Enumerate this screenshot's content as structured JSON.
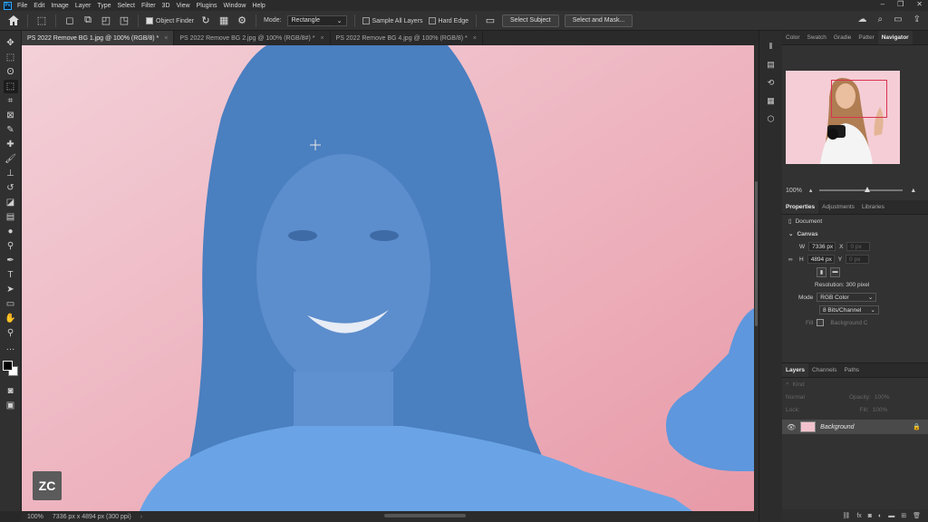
{
  "app": {
    "logo": "Ps"
  },
  "menu": [
    "File",
    "Edit",
    "Image",
    "Layer",
    "Type",
    "Select",
    "Filter",
    "3D",
    "View",
    "Plugins",
    "Window",
    "Help"
  ],
  "window_controls": [
    "–",
    "❐",
    "✕"
  ],
  "options": {
    "object_finder_label": "Object Finder",
    "mode_label": "Mode:",
    "mode_value": "Rectangle",
    "sample_all_layers": "Sample All Layers",
    "hard_edge": "Hard Edge",
    "select_subject": "Select Subject",
    "select_and_mask": "Select and Mask..."
  },
  "tabs": [
    {
      "label": "PS 2022 Remove BG 1.jpg @ 100% (RGB/8) *",
      "active": true
    },
    {
      "label": "PS 2022 Remove BG 2.jpg @ 100% (RGB/8#) *",
      "active": false
    },
    {
      "label": "PS 2022 Remove BG 4.jpg @ 100% (RGB/8) *",
      "active": false
    }
  ],
  "status": {
    "zoom": "100%",
    "doc_info": "7336 px x 4894 px (300 ppi)"
  },
  "navigator": {
    "tabs": [
      "Color",
      "Swatch",
      "Gradie",
      "Patter",
      "Navigator"
    ],
    "zoom": "100%"
  },
  "properties": {
    "tabs": [
      "Properties",
      "Adjustments",
      "Libraries"
    ],
    "document_label": "Document",
    "canvas_label": "Canvas",
    "w_label": "W",
    "w_value": "7336 px",
    "h_label": "H",
    "h_value": "4894 px",
    "x_label": "X",
    "x_value": "0 px",
    "y_label": "Y",
    "y_value": "0 px",
    "resolution": "Resolution: 300 pixel",
    "mode_label": "Mode",
    "mode_value": "RGB Color",
    "bits_value": "8 Bits/Channel",
    "fill_label": "Fill",
    "fill_value": "Background C"
  },
  "layers": {
    "tabs": [
      "Layers",
      "Channels",
      "Paths"
    ],
    "kind_filter": "Kind",
    "blend_mode": "Normal",
    "opacity_label": "Opacity:",
    "opacity_value": "100%",
    "lock_label": "Lock:",
    "fill_label": "Fill:",
    "fill_value": "100%",
    "layer_name": "Background"
  },
  "badge": "ZC",
  "colors": {
    "mask_overlay": "#4a8fd6",
    "background_pink": "#f0c6cf",
    "accent": "#31a8ff"
  }
}
